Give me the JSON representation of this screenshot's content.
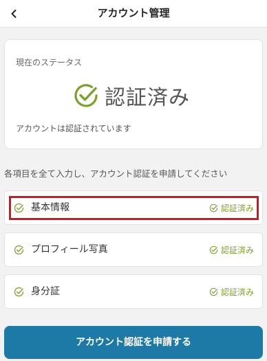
{
  "header": {
    "title": "アカウント管理",
    "back_icon": "chevron-left-icon"
  },
  "status_card": {
    "label": "現在のステータス",
    "status_text": "認証済み",
    "status_icon": "check-circle-icon",
    "description": "アカウントは認証されています"
  },
  "instruction": "各項目を全て入力し、アカウント認証を申請してください",
  "items": [
    {
      "label": "基本情報",
      "status": "認証済み",
      "icon": "check-circle-icon",
      "highlighted": true
    },
    {
      "label": "プロフィール写真",
      "status": "認証済み",
      "icon": "check-circle-icon",
      "highlighted": false
    },
    {
      "label": "身分証",
      "status": "認証済み",
      "icon": "check-circle-icon",
      "highlighted": false
    }
  ],
  "submit_button": {
    "label": "アカウント認証を申請する"
  },
  "colors": {
    "accent_green": "#7ca02c",
    "primary_blue": "#1d7aa6",
    "highlight_red": "#e0101e"
  }
}
